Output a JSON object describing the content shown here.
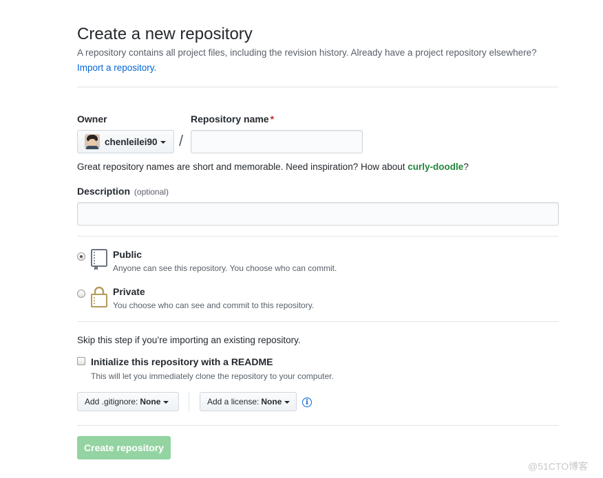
{
  "header": {
    "title": "Create a new repository",
    "description": "A repository contains all project files, including the revision history. Already have a project repository elsewhere?",
    "import_link": "Import a repository."
  },
  "owner": {
    "label": "Owner",
    "selected": "chenleilei90"
  },
  "repo_name": {
    "label": "Repository name",
    "required_marker": "*",
    "value": "",
    "separator": "/"
  },
  "name_hint": {
    "text": "Great repository names are short and memorable. Need inspiration? How about",
    "suggestion": "curly-doodle",
    "end": "?"
  },
  "description": {
    "label": "Description",
    "optional": "(optional)",
    "value": ""
  },
  "visibility": {
    "public": {
      "title": "Public",
      "note": "Anyone can see this repository. You choose who can commit.",
      "selected": true,
      "icon": "repo-book-icon"
    },
    "private": {
      "title": "Private",
      "note": "You choose who can see and commit to this repository.",
      "selected": false,
      "icon": "lock-icon"
    }
  },
  "init": {
    "skip_text": "Skip this step if you’re importing an existing repository.",
    "readme_label": "Initialize this repository with a README",
    "readme_note": "This will let you immediately clone the repository to your computer.",
    "readme_checked": false
  },
  "selects": {
    "gitignore_prefix": "Add .gitignore:",
    "gitignore_value": "None",
    "license_prefix": "Add a license:",
    "license_value": "None",
    "info_glyph": "i"
  },
  "submit": {
    "label": "Create repository",
    "enabled": false
  },
  "watermark": "@51CTO博客",
  "colors": {
    "link": "#0366d6",
    "required": "#cb2431",
    "suggestion": "#22863a",
    "submit_disabled": "#94d3a2",
    "lock_gold": "#b49a5a"
  }
}
